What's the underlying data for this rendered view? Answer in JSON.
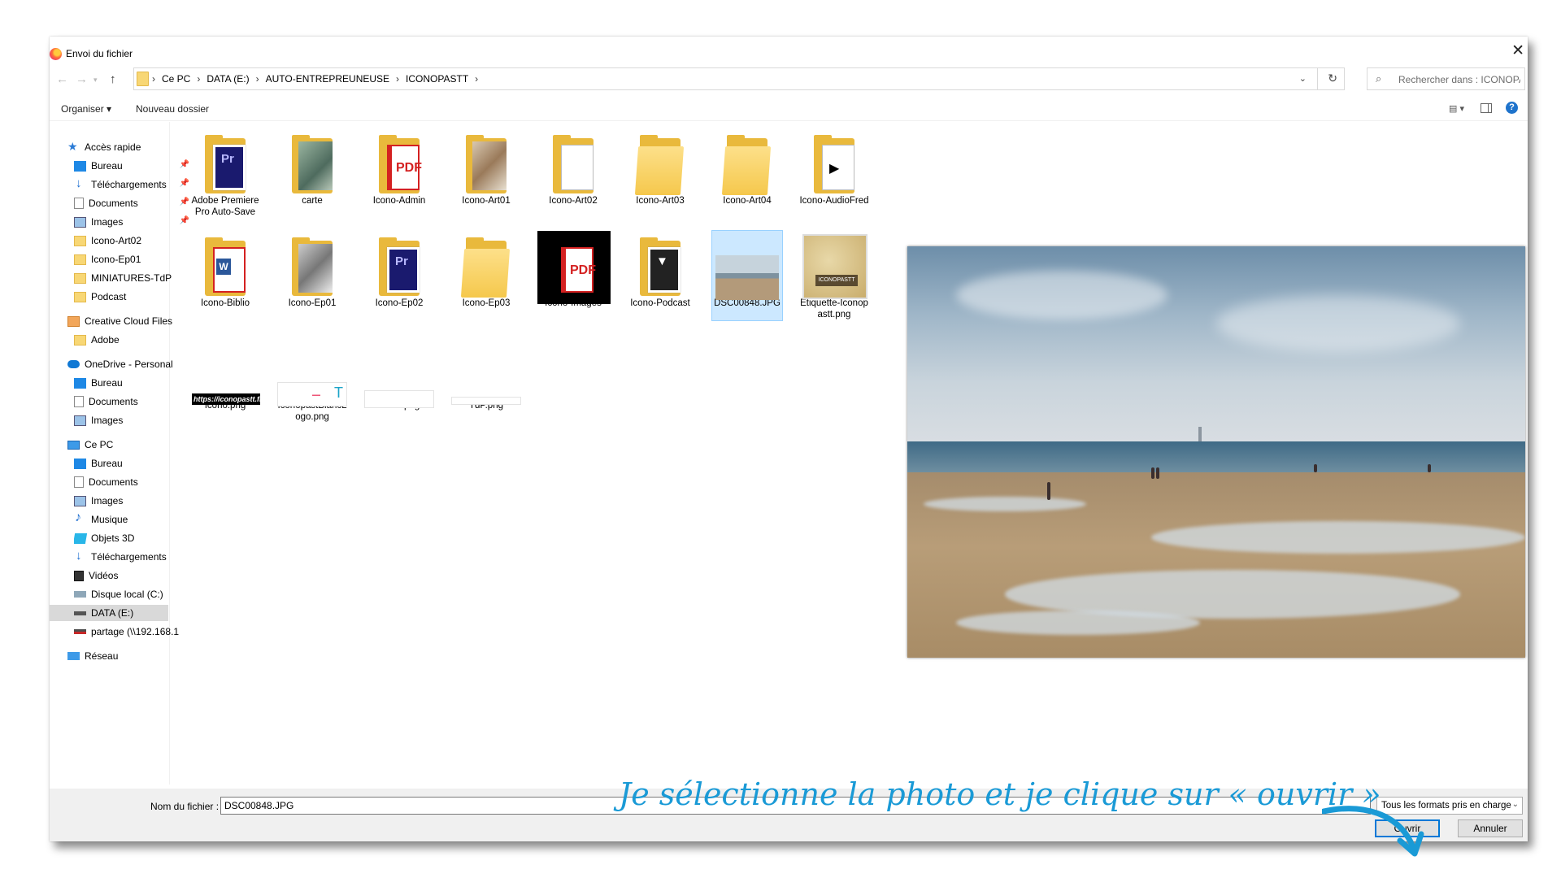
{
  "window": {
    "title": "Envoi du fichier"
  },
  "address": {
    "crumbs": [
      "Ce PC",
      "DATA (E:)",
      "AUTO-ENTREPREUNEUSE",
      "ICONOPASTT"
    ]
  },
  "search": {
    "placeholder": "Rechercher dans : ICONOPA..."
  },
  "toolbar": {
    "organize": "Organiser ▾",
    "new_folder": "Nouveau dossier"
  },
  "nav": {
    "quick_access": "Accès rapide",
    "qa_desktop": "Bureau",
    "qa_downloads": "Téléchargements",
    "qa_documents": "Documents",
    "qa_images": "Images",
    "qa_art02": "Icono-Art02",
    "qa_ep01": "Icono-Ep01",
    "qa_miniatures": "MINIATURES-TdP",
    "qa_podcast": "Podcast",
    "creative_cloud": "Creative Cloud Files",
    "cc_adobe": "Adobe",
    "onedrive": "OneDrive - Personal",
    "od_desktop": "Bureau",
    "od_documents": "Documents",
    "od_images": "Images",
    "this_pc": "Ce PC",
    "pc_desktop": "Bureau",
    "pc_documents": "Documents",
    "pc_images": "Images",
    "pc_music": "Musique",
    "pc_3d": "Objets 3D",
    "pc_downloads": "Téléchargements",
    "pc_videos": "Vidéos",
    "pc_local_disk": "Disque local (C:)",
    "pc_data": "DATA (E:)",
    "pc_share": "partage (\\\\192.168.1",
    "network": "Réseau"
  },
  "files": [
    {
      "name": "Adobe Premiere Pro Auto-Save"
    },
    {
      "name": "carte"
    },
    {
      "name": "Icono-Admin"
    },
    {
      "name": "Icono-Art01"
    },
    {
      "name": "Icono-Art02"
    },
    {
      "name": "Icono-Art03"
    },
    {
      "name": "Icono-Art04"
    },
    {
      "name": "Icono-AudioFred"
    },
    {
      "name": "Icono-Biblio"
    },
    {
      "name": "Icono-Ep01"
    },
    {
      "name": "Icono-Ep02"
    },
    {
      "name": "Icono-Ep03"
    },
    {
      "name": "Icono-Images"
    },
    {
      "name": "Icono-Podcast"
    },
    {
      "name": "DSC00848.JPG"
    },
    {
      "name": "Etiquette-Iconopastt.png"
    },
    {
      "name": "Icono.png",
      "thumb_text": "https://iconopastt.fr/"
    },
    {
      "name": "IconopastBlancLogo.png"
    },
    {
      "name": "Merci.png"
    },
    {
      "name": "TdP.png"
    }
  ],
  "bottom": {
    "filename_label": "Nom du fichier :",
    "filename_value": "DSC00848.JPG",
    "filter": "Tous les formats pris en charge",
    "open": "Ouvrir",
    "cancel": "Annuler"
  },
  "annotation": "Je sélectionne la photo et je clique sur « ouvrir »",
  "colors": {
    "accent": "#0078d7",
    "annotation": "#1a9ad6",
    "folder": "#f8d775"
  }
}
